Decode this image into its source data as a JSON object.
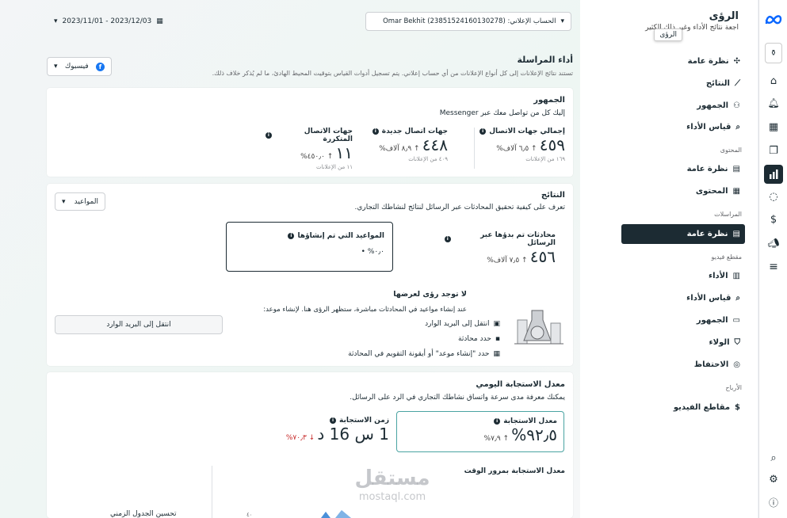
{
  "sidebar": {
    "title": "الرؤى",
    "subtitle": "اجعة نتائج الأداء وغير ذلك الكثير",
    "tooltip": "الرؤى",
    "items": [
      {
        "label": "نظرة عامة",
        "icon": "nodes-icon"
      },
      {
        "label": "النتائج",
        "icon": "trend-icon"
      },
      {
        "label": "الجمهور",
        "icon": "people-icon"
      },
      {
        "label": "قياس الأداء",
        "icon": "measure-icon"
      }
    ],
    "section_content": "المحتوى",
    "content_items": [
      {
        "label": "نظرة عامة",
        "icon": "gallery-icon"
      },
      {
        "label": "المحتوى",
        "icon": "table-icon"
      }
    ],
    "section_messages": "المراسلات",
    "messages_items": [
      {
        "label": "نظرة عامة",
        "icon": "gallery-icon"
      }
    ],
    "section_video": "مقطع فيديو",
    "video_items": [
      {
        "label": "الأداء",
        "icon": "doc-icon"
      },
      {
        "label": "قياس الأداء",
        "icon": "measure-icon"
      },
      {
        "label": "الجمهور",
        "icon": "video-icon"
      },
      {
        "label": "الولاء",
        "icon": "shield-icon"
      },
      {
        "label": "الاحتفاظ",
        "icon": "user-circle-icon"
      }
    ],
    "section_earnings": "الأرباح",
    "earnings_items": [
      {
        "label": "مقاطع الفيديو",
        "icon": "dollar-icon"
      }
    ]
  },
  "header": {
    "date_range": "2023/11/01 - 2023/12/03",
    "ad_account": "الحساب الإعلاني: Omar Bekhit (23851524160130278)"
  },
  "page": {
    "title": "أداء المراسلة",
    "description": "تستند نتائج الإعلانات إلى كل أنواع الإعلانات من أي حساب إعلاني. يتم تسجيل أدوات القياس بتوقيت المحيط الهادئ، ما لم يُذكر خلاف ذلك.",
    "platform": "فيسبوك"
  },
  "audience": {
    "title": "الجمهور",
    "desc": "إليك كل من تواصل معك عبر Messenger",
    "metrics": [
      {
        "label": "إجمالي جهات الاتصال",
        "value": "٤٥٩",
        "change": "↑ ٦٫٥ آلاف%",
        "foot": "١٦٩ من الإعلانات"
      },
      {
        "label": "جهات اتصال جديدة",
        "value": "٤٤٨",
        "change": "↑ ٨٫٩ آلاف%",
        "foot": "٤٠٩ من الإعلانات"
      },
      {
        "label": "جهات الاتصال المتكررة",
        "value": "١١",
        "change": "↑ ٤٥٠٫٠%",
        "foot": "١١ من الإعلانات"
      }
    ]
  },
  "results": {
    "title": "النتائج",
    "desc": "تعرف على كيفية تحقيق المحادثات عبر الرسائل لنتائج لنشاطك التجاري.",
    "dropdown": "المواعيد",
    "conv_label": "محادثات تم بدؤها عبر الرسائل",
    "conv_value": "٤٥٦",
    "conv_change": "↑ ٧٫٥ آلاف%",
    "appt_label": "المواعيد التي تم إنشاؤها",
    "appt_value": "٠٫٠%",
    "no_insights_title": "لا توجد رؤى لعرضها",
    "no_insights_desc": "عند إنشاء مواعيد في المحادثات مباشرة، ستظهر الرؤى هنا. لإنشاء موعد:",
    "steps": [
      "انتقل إلى البريد الوارد",
      "حدد محادثة",
      "حدد \"إنشاء موعد\" أو أيقونة التقويم في المحادثة"
    ],
    "inbox_button": "انتقل إلى البريد الوارد"
  },
  "response": {
    "title": "معدل الاستجابة اليومي",
    "desc": "يمكنك معرفة مدى سرعة واتساق نشاطك التجاري في الرد على الرسائل.",
    "rate_label": "معدل الاستجابة",
    "rate_value": "٩٢٫٥%",
    "rate_change": "↑ ٧٫٩%",
    "time_label": "زمن الاستجابة",
    "time_value": "1 س 16 د",
    "time_change": "↓ ٧٠٫٣%",
    "over_time": "معدل الاستجابة بمرور الوقت",
    "improve": "تحسين الجدول الزمني",
    "y_tick": "٤٠"
  },
  "watermark": {
    "brand": "مستقل",
    "domain": "mostaql.com"
  },
  "colors": {
    "accent": "#1877f2",
    "dark": "#1c2b33",
    "teal_border": "#4aa3a2"
  }
}
